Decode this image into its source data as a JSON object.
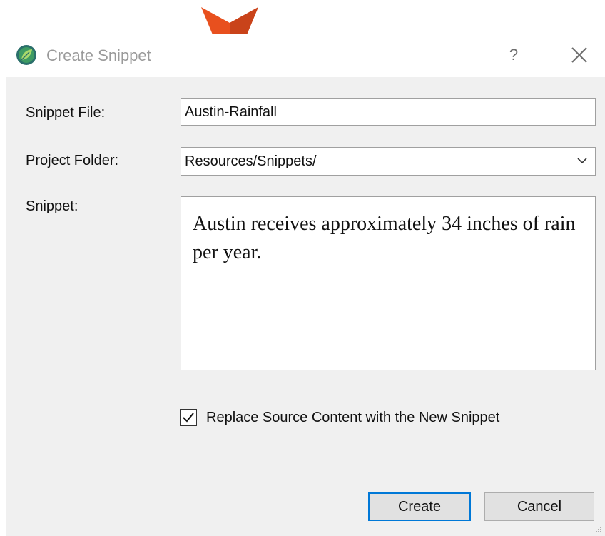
{
  "dialog": {
    "title": "Create Snippet",
    "help_glyph": "?",
    "app_icon": "leaf-logo-icon",
    "close_icon": "close-icon"
  },
  "form": {
    "snippet_file_label": "Snippet File:",
    "snippet_file_value": "Austin-Rainfall",
    "project_folder_label": "Project Folder:",
    "project_folder_value": "Resources/Snippets/",
    "snippet_label": "Snippet:",
    "snippet_text": "Austin receives approximately 34 inches of rain per year.",
    "replace_checkbox_label": "Replace Source Content with the New Snippet",
    "replace_checked": true
  },
  "buttons": {
    "create": "Create",
    "cancel": "Cancel"
  },
  "colors": {
    "pointer": "#e8501e",
    "focus_border": "#0078d7",
    "app_icon": "#2e8b57"
  }
}
